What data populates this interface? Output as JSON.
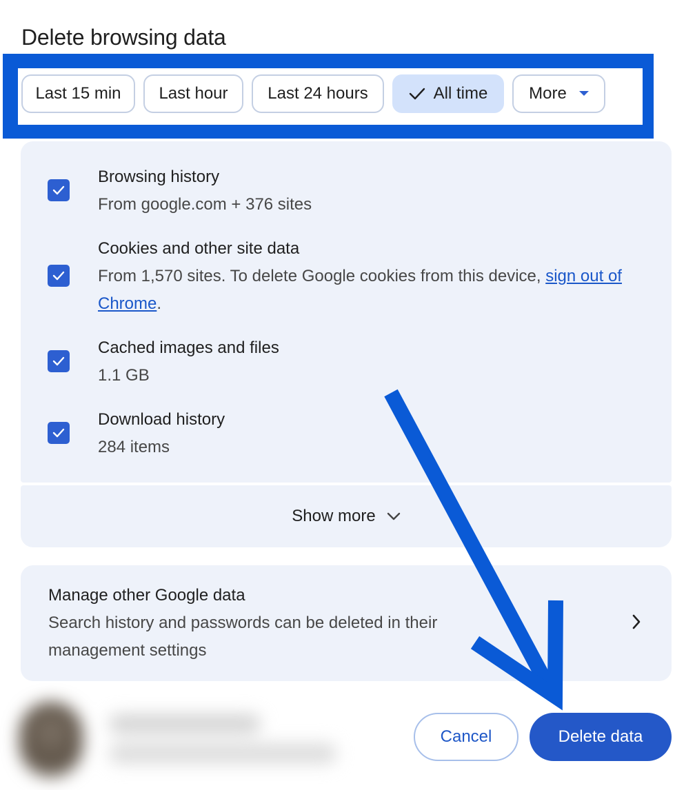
{
  "dialog": {
    "title": "Delete browsing data"
  },
  "time_ranges": [
    {
      "label": "Last 15 min",
      "selected": false
    },
    {
      "label": "Last hour",
      "selected": false
    },
    {
      "label": "Last 24 hours",
      "selected": false
    },
    {
      "label": "All time",
      "selected": true
    },
    {
      "label": "More",
      "selected": false
    }
  ],
  "options": [
    {
      "title": "Browsing history",
      "subtitle": "From google.com + 376 sites",
      "checked": true
    },
    {
      "title": "Cookies and other site data",
      "subtitle_prefix": "From 1,570 sites. To delete Google cookies from this device, ",
      "link_text": "sign out of Chrome",
      "subtitle_suffix": ".",
      "checked": true
    },
    {
      "title": "Cached images and files",
      "subtitle": "1.1 GB",
      "checked": true
    },
    {
      "title": "Download history",
      "subtitle": "284 items",
      "checked": true
    }
  ],
  "show_more": {
    "label": "Show more"
  },
  "manage": {
    "title": "Manage other Google data",
    "description": "Search history and passwords can be deleted in their management settings"
  },
  "footer": {
    "cancel_label": "Cancel",
    "delete_label": "Delete data"
  },
  "colors": {
    "accent": "#2458c8",
    "annotation": "#0a5ad6",
    "card_background": "#eef2fa",
    "selected_chip": "#d3e2fb"
  },
  "icons": {
    "check": "check-icon",
    "dropdown": "caret-down-icon",
    "show_more": "chevron-down-icon",
    "manage": "chevron-right-icon"
  }
}
